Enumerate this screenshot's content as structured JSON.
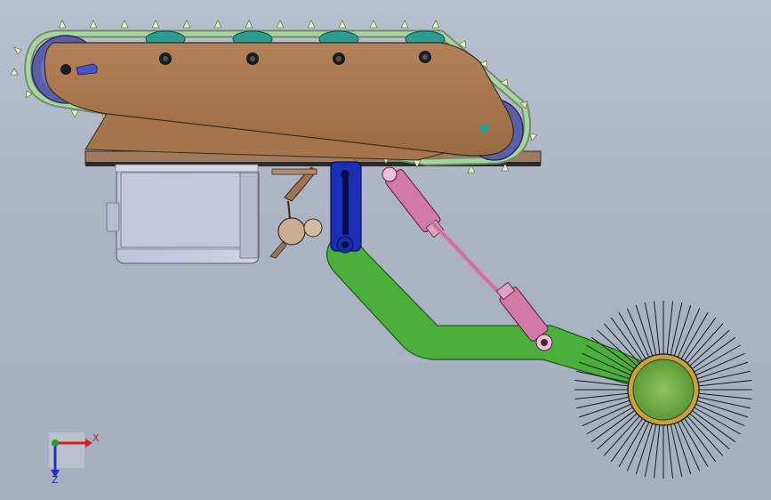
{
  "colors": {
    "background": "#aab4c4",
    "frame_plate": "#a8754b",
    "track_belt": "#9dc39a",
    "track_teeth": "#e7f0c0",
    "roller": "#5b5fa8",
    "roller_teal": "#2c9c93",
    "motor_box": "#c9cbe0",
    "arm_green": "#4caf3c",
    "bracket_blue": "#1d2fb8",
    "cylinder_pink": "#d27aa6",
    "brush_hub_outer": "#c9a23a",
    "brush_hub_inner": "#7ab04c",
    "bristle": "#1a1a1a",
    "axis_x": "#d02020",
    "axis_y": "#20a020",
    "axis_z": "#2030c0"
  },
  "triad": {
    "x_label": "X",
    "z_label": "Z"
  }
}
